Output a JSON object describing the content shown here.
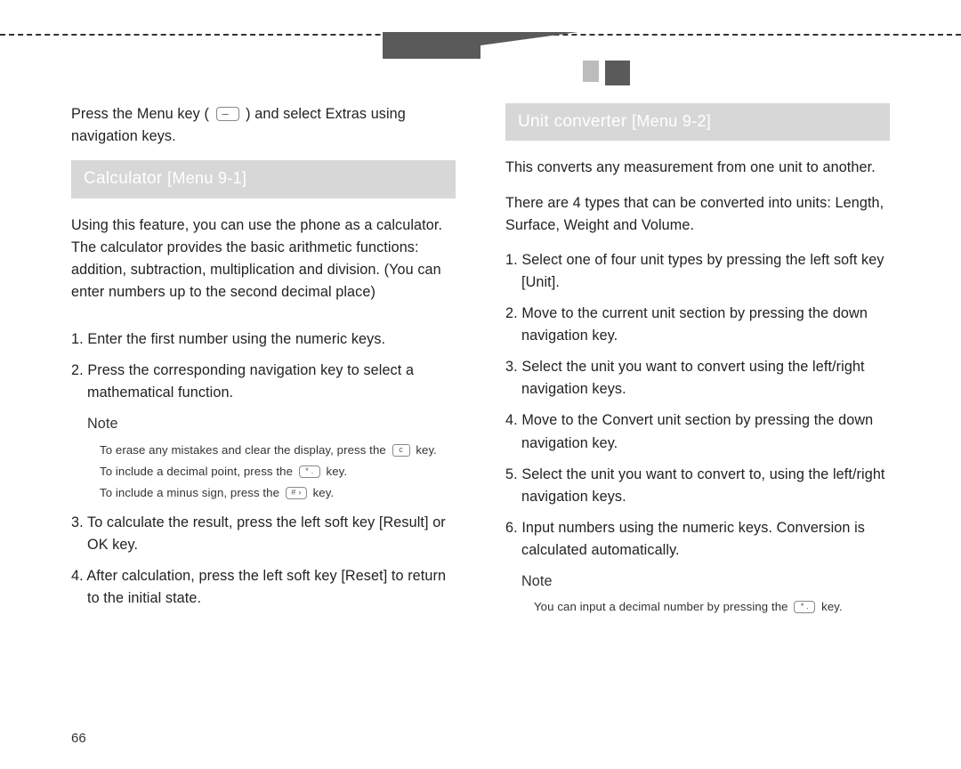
{
  "pageNumber": "66",
  "left": {
    "intro": "Press the Menu key ( – ) and select Extras using navigation keys.",
    "section": {
      "title": "Calculator",
      "menu": "[Menu 9-1]"
    },
    "desc": "Using this feature, you can use the phone as a calculator. The calculator provides the basic arithmetic functions: addition, subtraction, multiplication and division. (You can enter numbers up to the second decimal place)",
    "steps": [
      "Enter the first number using the numeric keys.",
      "Press the corresponding navigation key to select a mathematical function."
    ],
    "noteLabel": "Note",
    "noteLines": [
      "To erase any mistakes and clear the display, press the  c  key.",
      "To include a decimal point, press the  *  key.",
      "To include a minus sign, press the  #  key."
    ],
    "stepsAfter": [
      "To calculate the result, press the left soft key [Result] or OK key.",
      "After calculation, press the left soft key [Reset] to return to the initial state."
    ]
  },
  "right": {
    "section": {
      "title": "Unit converter",
      "menu": "[Menu 9-2]"
    },
    "p1": "This converts any measurement from one unit to another.",
    "p2": "There are 4 types that can be converted into units: Length, Surface, Weight and Volume.",
    "steps": [
      "Select one of four unit types by pressing the left soft key [Unit].",
      "Move to the current unit section by pressing the down navigation key.",
      "Select the unit you want to convert using the left/right navigation keys.",
      "Move to the Convert unit section by pressing the down navigation key.",
      "Select the unit you want to convert to, using the left/right navigation keys.",
      "Input numbers using the numeric keys. Conversion is calculated automatically."
    ],
    "noteLabel": "Note",
    "noteLine": "You can input a decimal number by pressing the  *  key."
  }
}
